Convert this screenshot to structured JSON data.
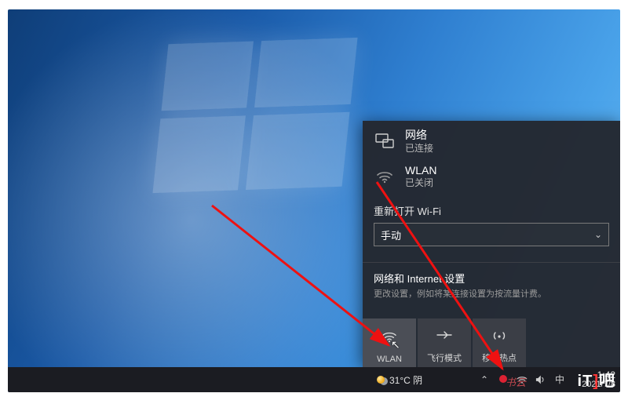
{
  "flyout": {
    "network": {
      "title": "网络",
      "status": "已连接"
    },
    "wlan": {
      "title": "WLAN",
      "status": "已关闭"
    },
    "reopen_label": "重新打开 Wi-Fi",
    "reopen_value": "手动",
    "settings_title": "网络和 Internet 设置",
    "settings_sub": "更改设置，例如将某连接设置为按流量计费。",
    "tiles": [
      {
        "label": "WLAN"
      },
      {
        "label": "飞行模式"
      },
      {
        "label": "移动热点"
      }
    ]
  },
  "taskbar": {
    "weather_text": "31°C 阴",
    "ime": "中",
    "time": "1:42",
    "date": "2021/7/8"
  },
  "watermark": {
    "script": "书云",
    "logo_left": "iT",
    "logo_right": "吧"
  }
}
